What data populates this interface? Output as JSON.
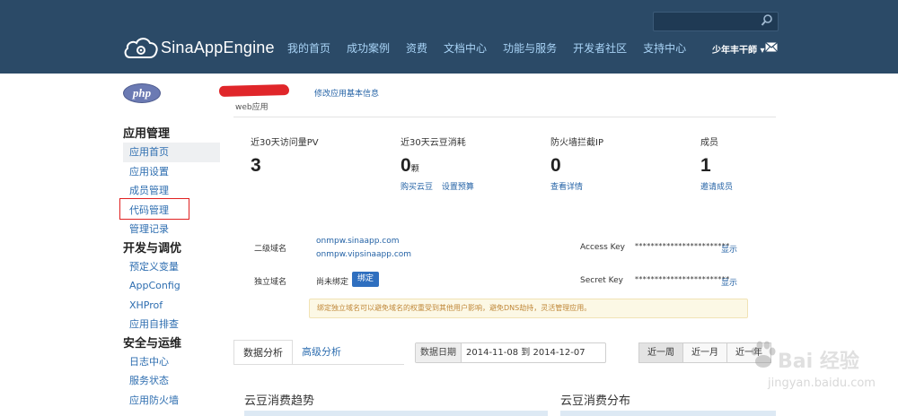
{
  "header": {
    "brand": "SinaAppEngine",
    "nav": [
      "我的首页",
      "成功案例",
      "资费",
      "文档中心",
      "功能与服务",
      "开发者社区",
      "支持中心"
    ],
    "user": "少年丰干師 ▾",
    "search_placeholder": ""
  },
  "app": {
    "lang_logo": "php",
    "type": "web应用",
    "edit_link": "修改应用基本信息"
  },
  "sidebar": {
    "sections": [
      {
        "title": "应用管理",
        "items": [
          "应用首页",
          "应用设置",
          "成员管理",
          "代码管理",
          "管理记录"
        ]
      },
      {
        "title": "开发与调优",
        "items": [
          "预定义变量",
          "AppConfig",
          "XHProf",
          "应用自排查"
        ]
      },
      {
        "title": "安全与运维",
        "items": [
          "日志中心",
          "服务状态",
          "应用防火墙"
        ]
      }
    ],
    "active_item": "应用首页",
    "highlighted_item": "代码管理"
  },
  "stats": [
    {
      "label": "近30天访问量PV",
      "value": "3",
      "unit": "",
      "links": []
    },
    {
      "label": "近30天云豆消耗",
      "value": "0",
      "unit": "颗",
      "links": [
        "购买云豆",
        "设置预算"
      ]
    },
    {
      "label": "防火墙拦截IP",
      "value": "0",
      "unit": "",
      "links": [
        "查看详情"
      ]
    },
    {
      "label": "成员",
      "value": "1",
      "unit": "",
      "links": [
        "邀请成员"
      ]
    }
  ],
  "domains": {
    "second_level_label": "二级域名",
    "second_level_values": [
      "onmpw.sinaapp.com",
      "onmpw.vipsinaapp.com"
    ],
    "custom_label": "独立域名",
    "custom_status": "尚未绑定",
    "bind_button": "绑定",
    "notice": "绑定独立域名可以避免域名的权重受到其他用户影响，避免DNS劫持，灵活管理应用。"
  },
  "keys": {
    "access_label": "Access Key",
    "access_value": "************************",
    "secret_label": "Secret Key",
    "secret_value": "************************",
    "show_link": "显示"
  },
  "analysis": {
    "tabs": [
      "数据分析",
      "高级分析"
    ],
    "date_label": "数据日期",
    "date_range": "2014-11-08 到 2014-12-07",
    "periods": [
      "近一周",
      "近一月",
      "近一年"
    ],
    "panels": [
      "云豆消费趋势",
      "云豆消费分布"
    ]
  },
  "watermark": {
    "text": "Bai 经验",
    "url": "jingyan.baidu.com"
  },
  "colors": {
    "header_bg": "#2b4a67",
    "nav_link": "#a9d4f7",
    "link": "#2563a6",
    "highlight_border": "#e02020",
    "bind_button": "#2f6fbf"
  }
}
